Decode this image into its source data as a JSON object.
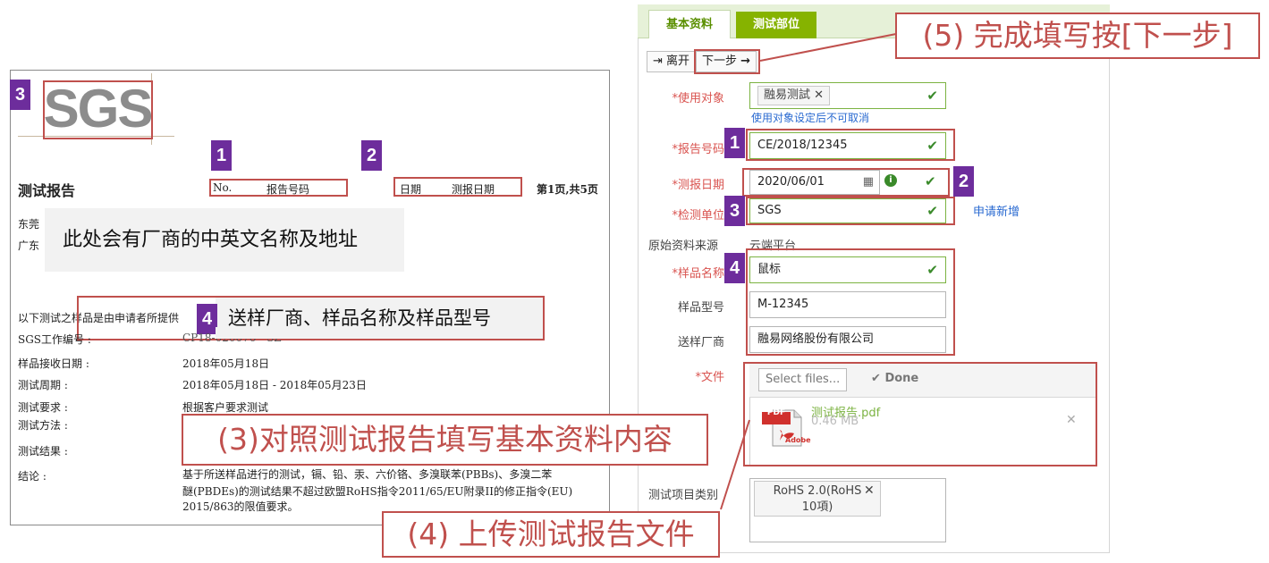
{
  "document": {
    "logo_text": "SGS",
    "title": "测试报告",
    "no_label": "No.",
    "no_value": "报告号码",
    "date_label": "日期",
    "date_value": "测报日期",
    "page_info": "第1页,共5页",
    "company_prefix_1": "东莞",
    "company_prefix_2": "广东",
    "company_callout": "此处会有厂商的中英文名称及地址",
    "sample_intro": "以下测试之样品是由申请者所提供",
    "sample_callout": "送样厂商、样品名称及样品型号",
    "rows": [
      {
        "label": "SGS工作编号 :",
        "value": "CP18-020076 - SZ"
      },
      {
        "label": "样品接收日期 :",
        "value": "2018年05月18日"
      },
      {
        "label": "测试周期 :",
        "value": "2018年05月18日 - 2018年05月23日"
      },
      {
        "label": "测试要求 :",
        "value": "根据客户要求测试"
      },
      {
        "label": "测试方法 :",
        "value": ""
      },
      {
        "label": "测试结果 :",
        "value": ""
      },
      {
        "label": "结论 :",
        "value": "基于所送样品进行的测试，镉、铅、汞、六价铬、多溴联苯(PBBs)、多溴二苯"
      }
    ],
    "conclusion_line2": "醚(PBDEs)的测试结果不超过欧盟RoHS指令2011/65/EU附录II的修正指令(EU)",
    "conclusion_line3": "2015/863的限值要求。"
  },
  "badges": {
    "one": "1",
    "two": "2",
    "three": "3",
    "four": "4"
  },
  "annotations": {
    "step3": "(3)对照测试报告填写基本资料内容",
    "step4": "(4) 上传测试报告文件",
    "step5": "(5) 完成填写按[下一步]"
  },
  "form": {
    "tabs": [
      "基本资料",
      "测试部位"
    ],
    "toolbar": {
      "leave": "离开",
      "next": "下一步"
    },
    "fields": {
      "target_label": "*使用对象",
      "target_tag": "融易测試",
      "target_note": "使用对象设定后不可取消",
      "report_no_label": "*报告号码",
      "report_no_value": "CE/2018/12345",
      "report_date_label": "*测报日期",
      "report_date_value": "2020/06/01",
      "lab_label": "*检测单位",
      "lab_value": "SGS",
      "lab_apply": "申请新增",
      "source_label": "原始资料来源",
      "source_value": "云端平台",
      "sample_name_label": "*样品名称",
      "sample_name_value": "鼠标",
      "sample_model_label": "样品型号",
      "sample_model_value": "M-12345",
      "vendor_label": "送样厂商",
      "vendor_value": "融易网络股份有限公司",
      "file_label": "*文件",
      "select_files": "Select files...",
      "done": "Done",
      "file_name": "测试报告.pdf",
      "file_size": "0.46 MB",
      "pdf_label": "PDF",
      "adobe_label": "Adobe",
      "test_category_label": "测试项目类别",
      "test_category_tag_line1": "RoHS 2.0(RoHS",
      "test_category_tag_line2": "10項)"
    }
  },
  "colors": {
    "accent_green": "#86b300",
    "annotation_red": "#c0504d",
    "badge_purple": "#6d2d9c",
    "link_blue": "#2a6ad1"
  }
}
